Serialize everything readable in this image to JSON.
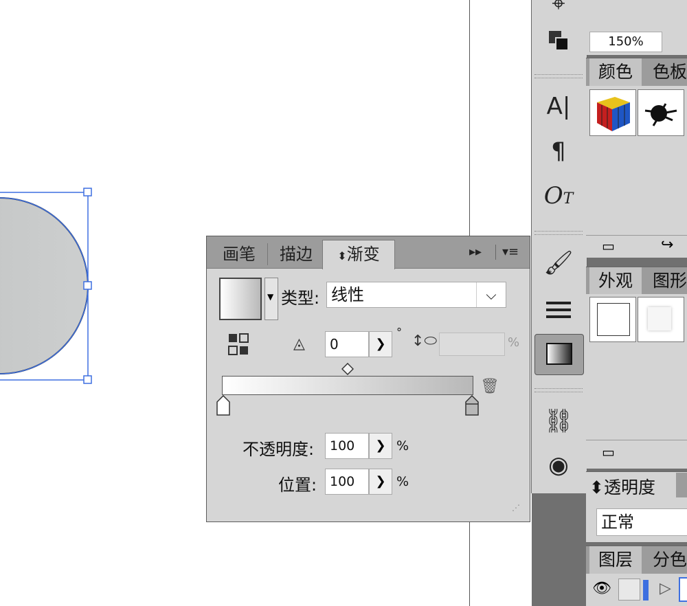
{
  "zoom": {
    "value": "150%"
  },
  "gradient_panel": {
    "tabs": [
      "画笔",
      "描边",
      "渐变"
    ],
    "active_tab_prefix": "⬍",
    "type_label": "类型:",
    "type_value": "线性",
    "angle_value": "0",
    "degree_symbol": "°",
    "aspect_unit": "%",
    "opacity_label": "不透明度:",
    "opacity_value": "100",
    "opacity_unit": "%",
    "location_label": "位置:",
    "location_value": "100",
    "location_unit": "%",
    "gradient_start_color": "#ffffff",
    "gradient_end_color": "#b8b8b8"
  },
  "right_panels": {
    "color_tabs": [
      "颜色",
      "色板"
    ],
    "appearance_tabs": [
      "外观",
      "图形"
    ],
    "transparency_title": "透明度",
    "blend_mode": "正常",
    "layers_tabs": [
      "图层",
      "分色"
    ]
  },
  "colors": {
    "selection_blue": "#3d6fe0",
    "circle_fill": "#c6c8c8"
  }
}
